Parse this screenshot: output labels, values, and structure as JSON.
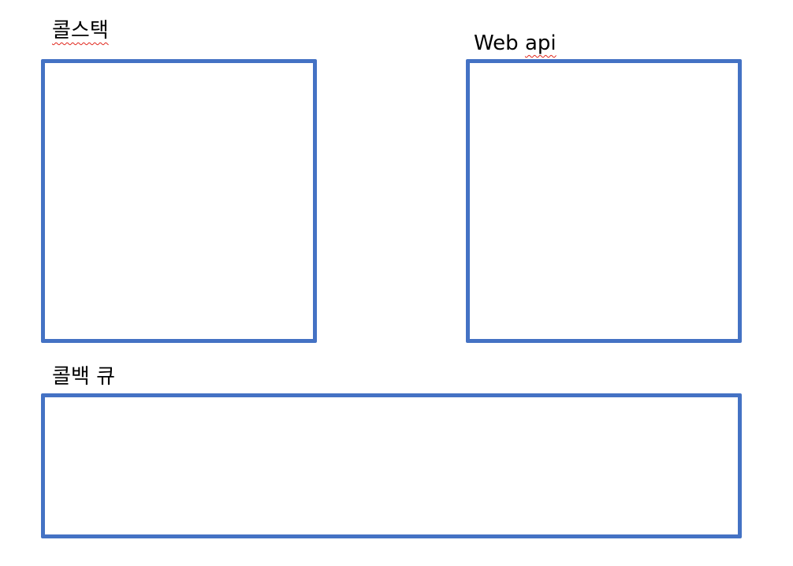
{
  "diagram": {
    "colors": {
      "box_border": "#4472c4",
      "spellcheck_underline": "#e0251b",
      "text": "#000000"
    },
    "call_stack": {
      "label": "콜스택"
    },
    "web_api": {
      "label_word1": "Web",
      "label_word2": "api"
    },
    "callback_queue": {
      "label_word1": "콜백",
      "label_word2": "큐"
    }
  }
}
